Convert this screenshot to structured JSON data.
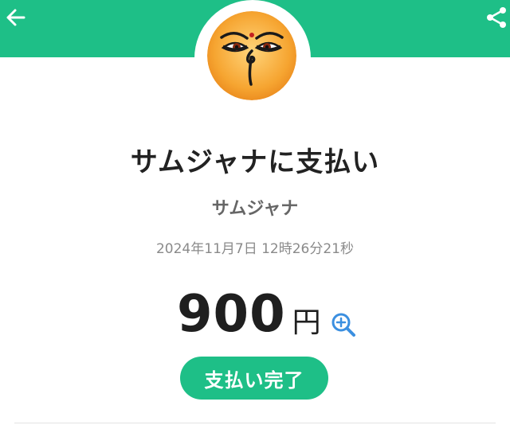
{
  "header": {
    "back_icon": "arrow-left-icon",
    "share_icon": "share-icon",
    "accent_color": "#1ebf87"
  },
  "merchant": {
    "avatar_icon": "buddha-eyes-logo",
    "title": "サムジャナに支払い",
    "name": "サムジャナ"
  },
  "transaction": {
    "datetime": "2024年11月7日 12時26分21秒",
    "amount": "900",
    "currency": "円",
    "zoom_icon": "zoom-in-icon",
    "status": "支払い完了"
  }
}
